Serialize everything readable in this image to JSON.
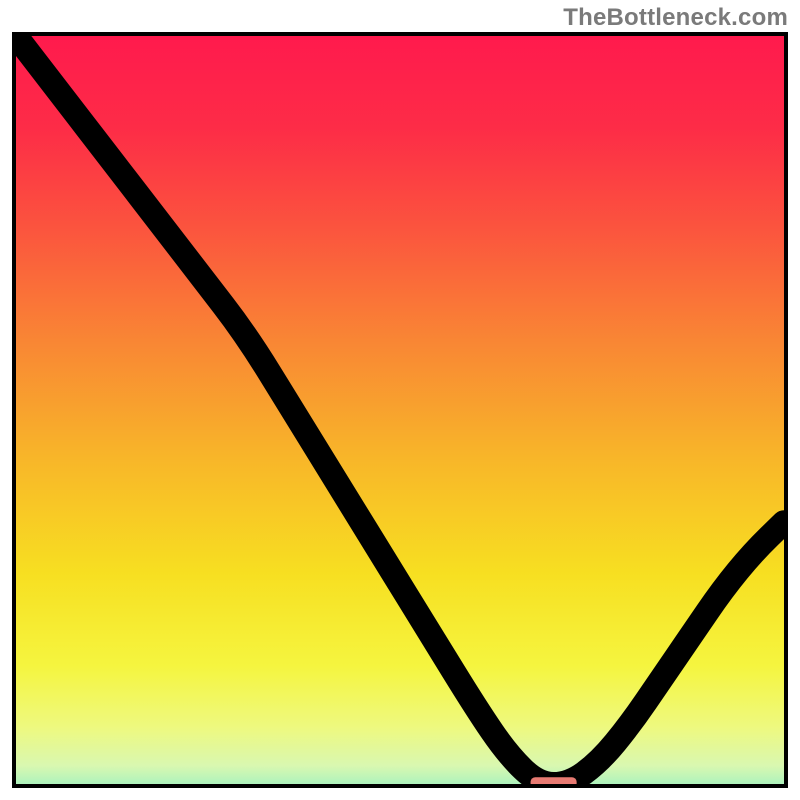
{
  "watermark": "TheBottleneck.com",
  "chart_data": {
    "type": "line",
    "title": "",
    "xlabel": "",
    "ylabel": "",
    "xlim": [
      0,
      100
    ],
    "ylim": [
      0,
      100
    ],
    "background_gradient_stops": [
      {
        "offset": 0.0,
        "color": "#ff1a4d"
      },
      {
        "offset": 0.12,
        "color": "#fd2c47"
      },
      {
        "offset": 0.25,
        "color": "#fb543e"
      },
      {
        "offset": 0.4,
        "color": "#f98734"
      },
      {
        "offset": 0.55,
        "color": "#f8b629"
      },
      {
        "offset": 0.7,
        "color": "#f7df21"
      },
      {
        "offset": 0.82,
        "color": "#f5f53f"
      },
      {
        "offset": 0.9,
        "color": "#eef97f"
      },
      {
        "offset": 0.95,
        "color": "#d9f8b0"
      },
      {
        "offset": 0.985,
        "color": "#9af0c2"
      },
      {
        "offset": 1.0,
        "color": "#28d67d"
      }
    ],
    "series": [
      {
        "name": "bottleneck-curve",
        "x": [
          0,
          6,
          12,
          18,
          24,
          30,
          36,
          42,
          48,
          54,
          60,
          64,
          68,
          72,
          76,
          80,
          84,
          88,
          92,
          96,
          100
        ],
        "y": [
          100,
          92,
          84,
          76,
          68,
          60,
          50,
          40,
          30,
          20,
          10,
          4,
          0,
          0,
          3,
          8,
          14,
          20,
          26,
          31,
          35
        ]
      }
    ],
    "flat_marker": {
      "x_start": 67,
      "x_end": 73,
      "y": 0
    },
    "colors": {
      "curve": "#000000",
      "frame": "#000000",
      "marker": "#e77a72"
    }
  }
}
